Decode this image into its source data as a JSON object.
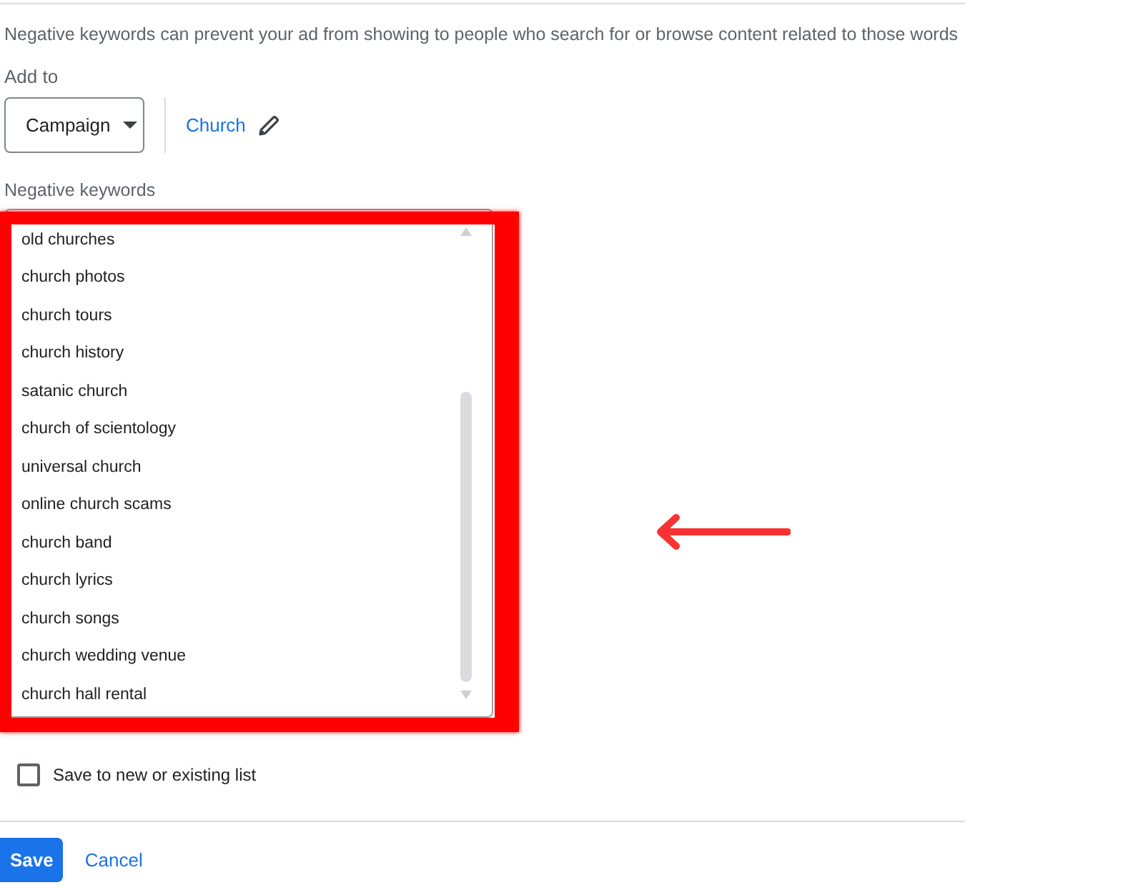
{
  "description": "Negative keywords can prevent your ad from showing to people who search for or browse content related to those words",
  "add_to": {
    "label": "Add to",
    "level_dropdown": {
      "value": "Campaign"
    },
    "target": {
      "name": "Church"
    }
  },
  "negative_keywords": {
    "label": "Negative keywords",
    "lines": [
      "old churches",
      "church photos",
      "church tours",
      "church history",
      "satanic church",
      "church of scientology",
      "universal church",
      "online church scams",
      "church band",
      "church lyrics",
      "church songs",
      "church wedding venue",
      "church hall rental"
    ]
  },
  "save_list": {
    "label": "Save to new or existing list",
    "checked": false
  },
  "buttons": [
    {
      "label": "Save",
      "kind": "primary"
    },
    {
      "label": "Cancel",
      "kind": "text"
    }
  ]
}
